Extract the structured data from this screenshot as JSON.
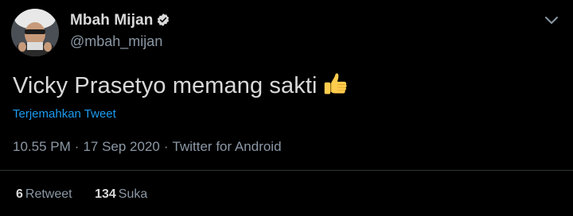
{
  "tweet": {
    "author": {
      "display_name": "Mbah Mijan",
      "handle": "@mbah_mijan",
      "verified": true
    },
    "text": "Vicky Prasetyo memang sakti",
    "emoji_icon": "thumbs-up-icon",
    "translate_label": "Terjemahkan Tweet",
    "meta": {
      "time": "10.55 PM",
      "date": "17 Sep 2020",
      "source": "Twitter for Android",
      "separator": "·"
    },
    "stats": {
      "retweets_count": "6",
      "retweets_label": "Retweet",
      "likes_count": "134",
      "likes_label": "Suka"
    }
  },
  "colors": {
    "background": "#000000",
    "primary_text": "#d9d9d9",
    "secondary_text": "#8b98a5",
    "link": "#1d9bf0",
    "divider": "#2f3336"
  }
}
